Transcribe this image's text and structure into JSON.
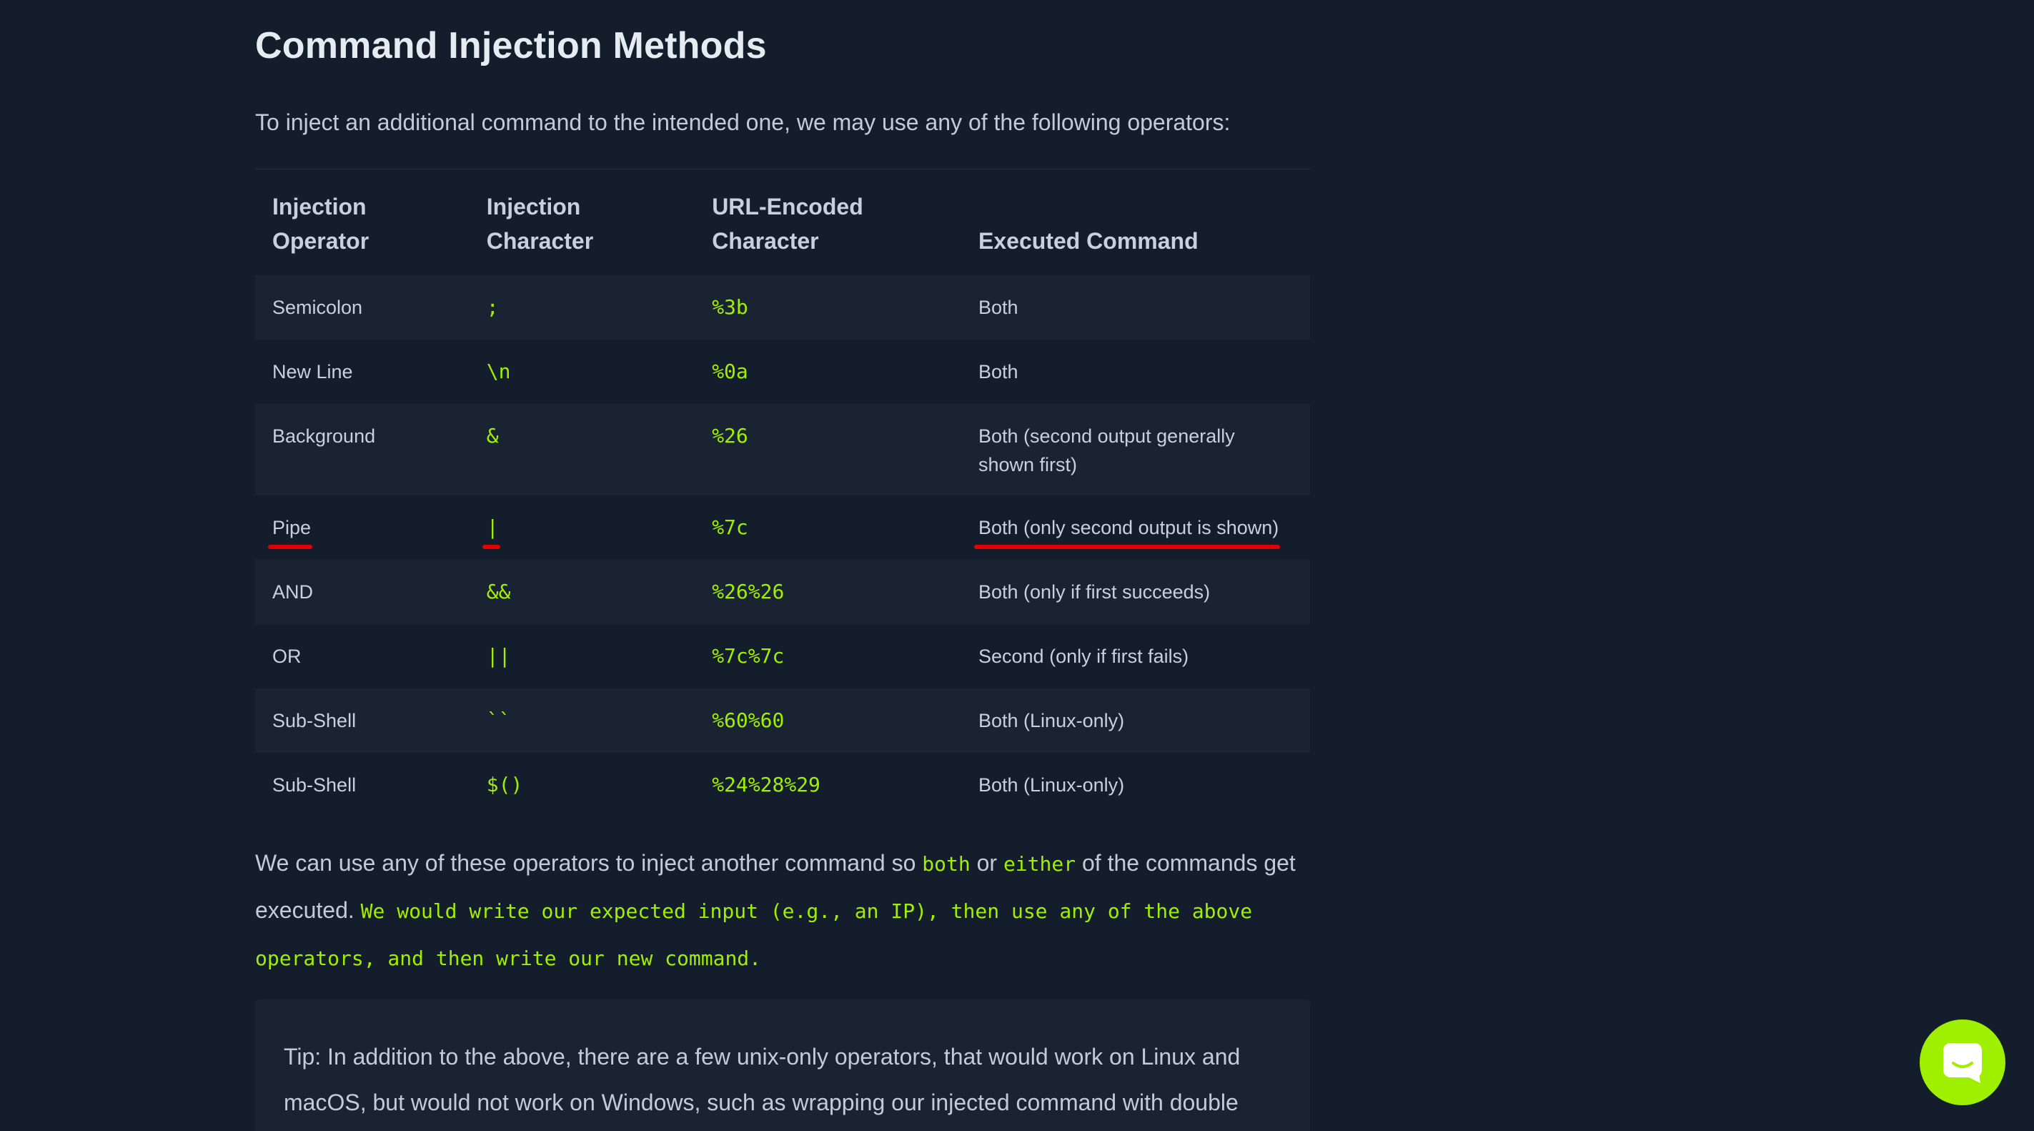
{
  "title": "Command Injection Methods",
  "intro": "To inject an additional command to the intended one, we may use any of the following operators:",
  "table": {
    "headers": [
      [
        "Injection",
        "Operator"
      ],
      [
        "Injection",
        "Character"
      ],
      [
        "URL-Encoded",
        "Character"
      ],
      [
        "Executed Command"
      ]
    ],
    "rows": [
      {
        "operator": "Semicolon",
        "character": ";",
        "encoded": "%3b",
        "executed": "Both"
      },
      {
        "operator": "New Line",
        "character": "\\n",
        "encoded": "%0a",
        "executed": "Both"
      },
      {
        "operator": "Background",
        "character": "&",
        "encoded": "%26",
        "executed": "Both (second output generally shown first)"
      },
      {
        "operator": "Pipe",
        "character": "|",
        "encoded": "%7c",
        "executed": "Both (only second output is shown)"
      },
      {
        "operator": "AND",
        "character": "&&",
        "encoded": "%26%26",
        "executed": "Both (only if first succeeds)"
      },
      {
        "operator": "OR",
        "character": "||",
        "encoded": "%7c%7c",
        "executed": "Second (only if first fails)"
      },
      {
        "operator": "Sub-Shell",
        "character": "``",
        "encoded": "%60%60",
        "executed": "Both (Linux-only)"
      },
      {
        "operator": "Sub-Shell",
        "character": "$()",
        "encoded": "%24%28%29",
        "executed": "Both (Linux-only)"
      }
    ]
  },
  "paragraph": {
    "part1": "We can use any of these operators to inject another command so ",
    "code1": "both",
    "part2": " or ",
    "code2": "either",
    "part3": " of the commands get executed. ",
    "code3": "We would write our expected input (e.g., an IP), then use any of the above operators, and then write our new command."
  },
  "tip": "Tip: In addition to the above, there are a few unix-only operators, that would work on Linux and macOS, but would not work on Windows, such as wrapping our injected command with double",
  "colors": {
    "background": "#141d2b",
    "row_alt": "#1a2332",
    "accent_green": "#9fef00",
    "annotation_red": "#e00000"
  },
  "chat_button_icon": "chat-bubble-icon"
}
